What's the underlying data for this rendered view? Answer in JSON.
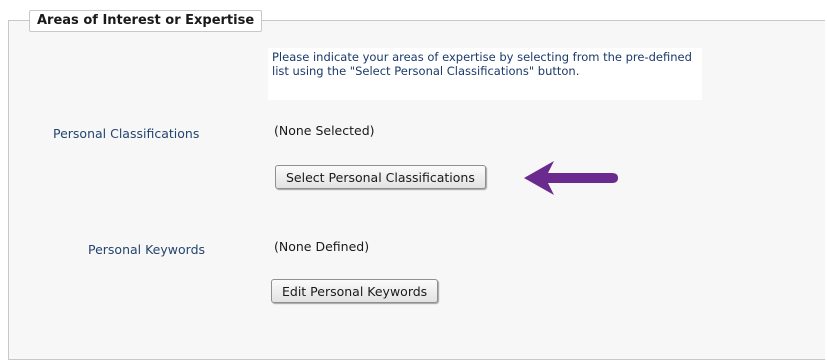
{
  "section": {
    "title": "Areas of Interest or Expertise",
    "instructions": "Please indicate your areas of expertise by selecting from the pre-defined list using the \"Select Personal Classifications\" button."
  },
  "classifications": {
    "label": "Personal Classifications",
    "value": "(None Selected)",
    "button_label": "Select Personal Classifications"
  },
  "keywords": {
    "label": "Personal Keywords",
    "value": "(None Defined)",
    "button_label": "Edit Personal Keywords"
  },
  "colors": {
    "label_text": "#24456e",
    "instruction_text": "#1b3a6b",
    "annotation_arrow": "#6a2a8e"
  },
  "icons": {
    "annotation": "arrow-left-icon"
  }
}
